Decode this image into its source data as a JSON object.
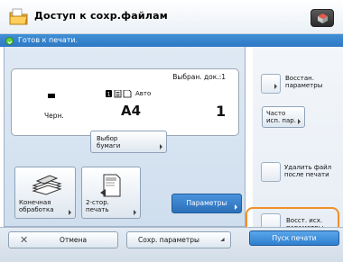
{
  "header": {
    "title": "Доступ к сохр.файлам",
    "icon": "folder-icon",
    "menu_icon": "menu-cube-icon"
  },
  "status": {
    "icon": "ready-check-icon",
    "text": "Готов к печати."
  },
  "summary": {
    "selected_docs": "Выбран. док.:1",
    "color_mode": "Черн.",
    "paper_auto": "Авто",
    "paper_size": "A4",
    "copies": "1"
  },
  "buttons": {
    "paper_select": "Выбор\nбумаги",
    "finishing": "Конечная\nобработка",
    "duplex": "2-стор.\nпечать",
    "parameters": "Параметры",
    "restore_params": "Восстан.\nпараметры",
    "favorites": "Часто\nисп. пар.",
    "delete_after_print": "Удалить файл\nпосле печати",
    "restore_default": "Восст. исх.\nпараметры",
    "cancel": "Отмена",
    "save_params": "Сохр. параметры",
    "start_print": "Пуск печати"
  },
  "colors": {
    "accent_blue": "#2e78c4",
    "highlight_orange": "#f0902a",
    "ready_green": "#5fd043"
  }
}
